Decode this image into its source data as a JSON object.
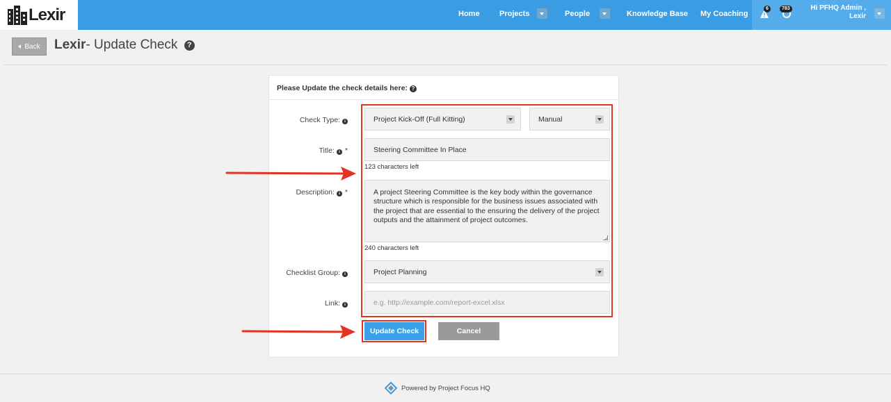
{
  "brand": {
    "name": "Lexir"
  },
  "nav": {
    "home": "Home",
    "projects": "Projects",
    "people": "People",
    "knowledge_base": "Knowledge Base",
    "my_coaching": "My Coaching",
    "alerts_count": "6",
    "updates_count": "783",
    "user_greeting": "Hi PFHQ Admin ,",
    "user_org": "Lexir"
  },
  "header": {
    "back_label": "Back",
    "title_bold": "Lexir",
    "title_rest": "- Update Check",
    "help_icon": "?"
  },
  "form": {
    "heading": "Please Update the check details here:",
    "check_type": {
      "label": "Check Type:",
      "value": "Project Kick-Off (Full Kitting)",
      "mode": "Manual"
    },
    "title": {
      "label": "Title:",
      "value": "Steering Committee In Place",
      "chars_left": "123 characters left"
    },
    "description": {
      "label": "Description:",
      "value": "A project Steering Committee is the key body within the governance structure which is responsible for the business issues associated with the project that are essential to the ensuring the delivery of the project outputs and the attainment of project outcomes.",
      "chars_left": "240 characters left"
    },
    "checklist_group": {
      "label": "Checklist Group:",
      "value": "Project Planning"
    },
    "link": {
      "label": "Link:",
      "placeholder": "e.g. http://example.com/report-excel.xlsx"
    },
    "required_mark": "*",
    "update_button": "Update Check",
    "cancel_button": "Cancel"
  },
  "footer": {
    "text": "Powered by Project Focus HQ"
  },
  "colors": {
    "nav_bg": "#3a9de4",
    "primary_button": "#3aa0e8",
    "annotation": "#e53322"
  }
}
